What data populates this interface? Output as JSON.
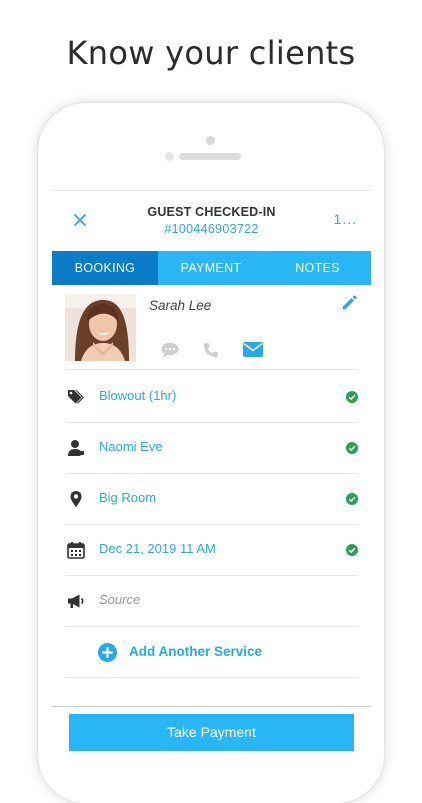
{
  "headline": "Know your clients",
  "header": {
    "title": "GUEST CHECKED-IN",
    "subtitle": "#100446903722",
    "more_label": "1..."
  },
  "tabs": [
    {
      "label": "BOOKING",
      "active": true
    },
    {
      "label": "PAYMENT",
      "active": false
    },
    {
      "label": "NOTES",
      "active": false
    }
  ],
  "client": {
    "name": "Sarah Lee",
    "contact_icons": [
      "chat-icon",
      "phone-icon",
      "email-icon"
    ]
  },
  "details": [
    {
      "icon": "tags-icon",
      "label": "Blowout (1hr)",
      "checked": true
    },
    {
      "icon": "user-icon",
      "label": "Naomi Eve",
      "checked": true
    },
    {
      "icon": "location-pin-icon",
      "label": "Big Room",
      "checked": true
    },
    {
      "icon": "calendar-icon",
      "label": "Dec 21, 2019 11 AM",
      "checked": true
    },
    {
      "icon": "megaphone-icon",
      "label": "Source",
      "checked": false
    }
  ],
  "add_service_label": "Add Another Service",
  "primary_action": "Take Payment",
  "colors": {
    "accent": "#27a9e6",
    "tab_bar": "#29b6f6",
    "tab_active": "#0a7cc8",
    "check": "#2aa05a"
  }
}
